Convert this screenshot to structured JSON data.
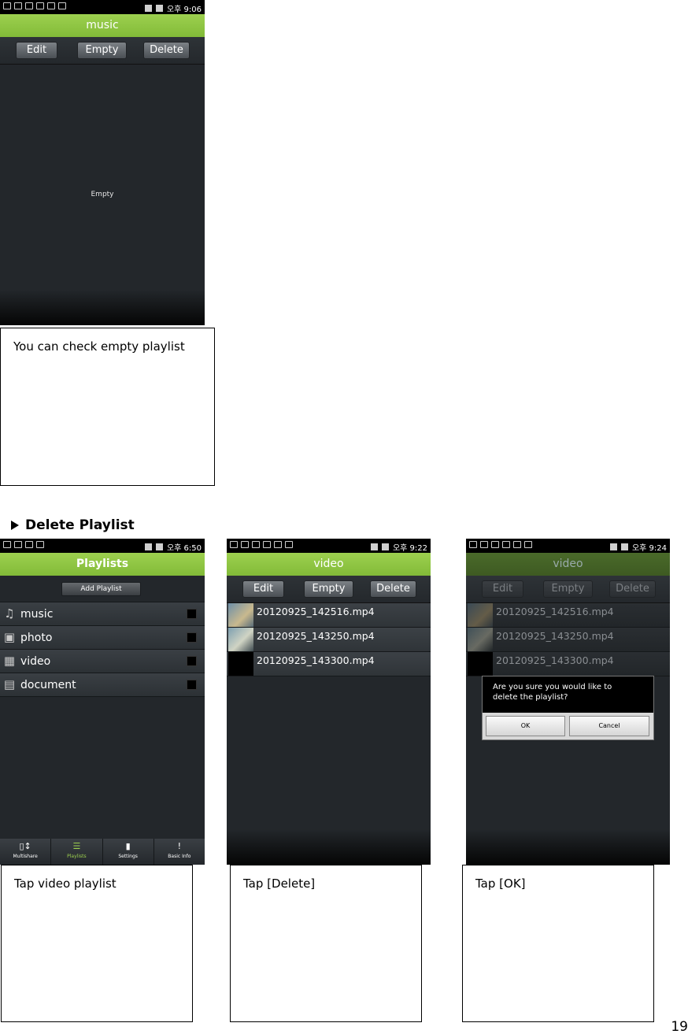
{
  "phone1": {
    "statusbar": {
      "time": "오후 9:06"
    },
    "title": "music",
    "toolbar": {
      "edit": "Edit",
      "empty": "Empty",
      "delete": "Delete"
    },
    "empty_text": "Empty"
  },
  "caption1": "You can check empty playlist",
  "section": {
    "title": "Delete Playlist"
  },
  "phone2": {
    "statusbar": {
      "time": "오후 6:50"
    },
    "title": "Playlists",
    "add_button": "Add Playlist",
    "playlists": [
      {
        "label": "music",
        "icon": "music-note-icon"
      },
      {
        "label": "photo",
        "icon": "photo-icon"
      },
      {
        "label": "video",
        "icon": "film-icon"
      },
      {
        "label": "document",
        "icon": "document-icon"
      }
    ],
    "nav": [
      {
        "label": "Multishare",
        "icon": "multishare-icon"
      },
      {
        "label": "Playlists",
        "icon": "list-icon"
      },
      {
        "label": "Settings",
        "icon": "settings-icon"
      },
      {
        "label": "Basic Info",
        "icon": "info-icon"
      }
    ]
  },
  "phone3": {
    "statusbar": {
      "time": "오후 9:22"
    },
    "title": "video",
    "toolbar": {
      "edit": "Edit",
      "empty": "Empty",
      "delete": "Delete"
    },
    "files": [
      "20120925_142516.mp4",
      "20120925_143250.mp4",
      "20120925_143300.mp4"
    ]
  },
  "phone4": {
    "statusbar": {
      "time": "오후 9:24"
    },
    "title": "video",
    "toolbar": {
      "edit": "Edit",
      "empty": "Empty",
      "delete": "Delete"
    },
    "files": [
      "20120925_142516.mp4",
      "20120925_143250.mp4",
      "20120925_143300.mp4"
    ],
    "dialog": {
      "message_line1": "Are you sure you would like to",
      "message_line2": "delete the playlist?",
      "ok": "OK",
      "cancel": "Cancel"
    }
  },
  "captions": {
    "c2": "Tap video playlist",
    "c3": "Tap [Delete]",
    "c4": "Tap [OK]"
  },
  "page_number": "19",
  "colors": {
    "accent_green": "#8dc343",
    "phone_bg": "#23272b"
  }
}
